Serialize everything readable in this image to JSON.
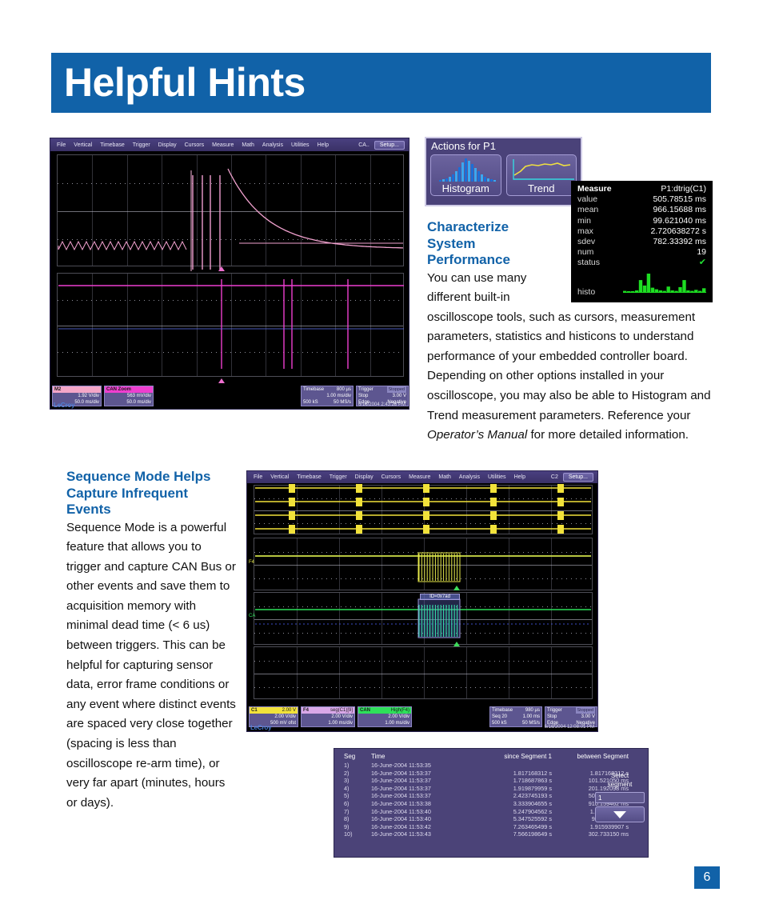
{
  "page": {
    "title": "Helpful Hints",
    "number": "6",
    "accent_color": "#1162a8"
  },
  "scope_top": {
    "menu_items": [
      "File",
      "Vertical",
      "Timebase",
      "Trigger",
      "Display",
      "Cursors",
      "Measure",
      "Math",
      "Analysis",
      "Utilities",
      "Help"
    ],
    "channel_label": "CA..",
    "setup_label": "Setup...",
    "traces": [
      {
        "name": "M2",
        "badge": "",
        "volts": "1.92 V/div",
        "time": "50.0 ms/div",
        "color": "#f4a6c8"
      },
      {
        "name": "CAN Zoom",
        "badge": "",
        "volts": "563 mV/div",
        "time": "50.0 ms/div",
        "color": "#ee3fcf"
      }
    ],
    "timebase": {
      "label": "Timebase",
      "value": "800 µs",
      "per_div": "1.00 ms/div",
      "memory": "500 kS",
      "rate": "50 MS/s"
    },
    "trigger": {
      "label": "Trigger",
      "mode": "Stop",
      "state_badge": "Stopped",
      "level": "3.00 V",
      "type": "Edge",
      "slope": "Negative"
    },
    "brand": "LeCroy",
    "timestamp": "6/16/2004 2:43:25 PM"
  },
  "actions_p1": {
    "title": "Actions for P1",
    "buttons": [
      {
        "label": "Histogram",
        "icon": "histogram-icon"
      },
      {
        "label": "Trend",
        "icon": "trend-icon"
      }
    ]
  },
  "measure_panel": {
    "title": "Measure",
    "source": "P1:dtrig(C1)",
    "rows": [
      {
        "label": "value",
        "value": "505.78515 ms"
      },
      {
        "label": "mean",
        "value": "966.15688 ms"
      },
      {
        "label": "min",
        "value": "99.621040 ms"
      },
      {
        "label": "max",
        "value": "2.720638272 s"
      },
      {
        "label": "sdev",
        "value": "782.33392 ms"
      },
      {
        "label": "num",
        "value": "19"
      },
      {
        "label": "status",
        "value": "✔"
      }
    ],
    "histo_label": "histo",
    "histo_bars": [
      2,
      1,
      1,
      3,
      22,
      12,
      34,
      8,
      5,
      3,
      2,
      10,
      3,
      2,
      9,
      22,
      3,
      2,
      4,
      2,
      7
    ],
    "histo_color": "#1ddd22"
  },
  "article_right": {
    "heading": "Characterize System Performance",
    "body_part1": "You can use many different built-in",
    "body_part2": "oscilloscope  tools, such as cursors, measurement parameters, statistics and histicons to understand performance of your embedded controller board. Depending on other options installed in your oscilloscope, you may also be able to Histogram and Trend measurement parameters.  Reference your ",
    "body_italic": "Operator’s Manual",
    "body_part3": " for more detailed information."
  },
  "article_left": {
    "heading": "Sequence Mode Helps Capture Infrequent Events",
    "body": "Sequence Mode is a powerful feature that allows you to trigger and capture CAN Bus or other events and save them to acquisition memory with minimal dead time (< 6 us) between triggers.  This can be helpful for capturing sensor data, error frame conditions or any event where distinct events are spaced very close together (spacing is less than oscilloscope re-arm time), or very far apart (minutes, hours or days)."
  },
  "scope_bottom": {
    "menu_items": [
      "File",
      "Vertical",
      "Timebase",
      "Trigger",
      "Display",
      "Cursors",
      "Measure",
      "Math",
      "Analysis",
      "Utilities",
      "Help"
    ],
    "channel_label": "C2",
    "setup_label": "Setup...",
    "decode_label": "ID=0x7ad",
    "trace_markers": [
      "F4",
      "CA"
    ],
    "traces": [
      {
        "name": "C1",
        "badge": "2.00 V",
        "volts": "2.00 V/div",
        "time": "500 mV ofst",
        "color": "#f2e23a"
      },
      {
        "name": "F4",
        "badge": "seg(C1)[9]",
        "volts": "2.00 V/div",
        "time": "1.00 ms/div",
        "color": "#d9a8e8"
      },
      {
        "name": "CAN",
        "badge": "High(F4)",
        "volts": "2.00 V/div",
        "time": "1.00 ms/div",
        "color": "#2ee05a"
      }
    ],
    "timebase": {
      "label": "Timebase",
      "value": "980 µs",
      "seq": "Seq 20",
      "per_div": "1.00 ms",
      "memory": "500 kS",
      "rate": "50 MS/s"
    },
    "trigger": {
      "label": "Trigger",
      "state_badge": "Stopped",
      "mode": "Stop",
      "level": "3.00 V",
      "type": "Edge",
      "slope": "Negative"
    },
    "brand": "LeCroy",
    "timestamp": "6/16/2004 12:08:01 PM"
  },
  "segment_table": {
    "headers": [
      "Seg",
      "Time",
      "since Segment 1",
      "between Segment"
    ],
    "rows": [
      {
        "seg": "1)",
        "time": "16-June-2004  11:53:35",
        "since": "",
        "between": ""
      },
      {
        "seg": "2)",
        "time": "16-June-2004  11:53:37",
        "since": "1.817168312 s",
        "between": "1.817168312 s"
      },
      {
        "seg": "3)",
        "time": "16-June-2004  11:53:37",
        "since": "1.718687863 s",
        "between": "101.521050 ms"
      },
      {
        "seg": "4)",
        "time": "16-June-2004  11:53:37",
        "since": "1.919879959 s",
        "between": "201.192098 ms"
      },
      {
        "seg": "5)",
        "time": "16-June-2004  11:53:37",
        "since": "2.423745193 s",
        "between": "503.865234 ms"
      },
      {
        "seg": "6)",
        "time": "16-June-2004  11:53:38",
        "since": "3.333904655 s",
        "between": "910.159462 ms"
      },
      {
        "seg": "7)",
        "time": "16-June-2004  11:53:40",
        "since": "5.247904562 s",
        "between": "1.913898897 s"
      },
      {
        "seg": "8)",
        "time": "16-June-2004  11:53:40",
        "since": "5.347525592 s",
        "between": "99.621040 ms"
      },
      {
        "seg": "9)",
        "time": "16-June-2004  11:53:42",
        "since": "7.263465499 s",
        "between": "1.915939907 s"
      },
      {
        "seg": "10)",
        "time": "16-June-2004  11:53:43",
        "since": "7.566198649 s",
        "between": "302.733150 ms"
      }
    ],
    "select_label_line1": "Select",
    "select_label_line2": "segment",
    "select_value": "1"
  }
}
